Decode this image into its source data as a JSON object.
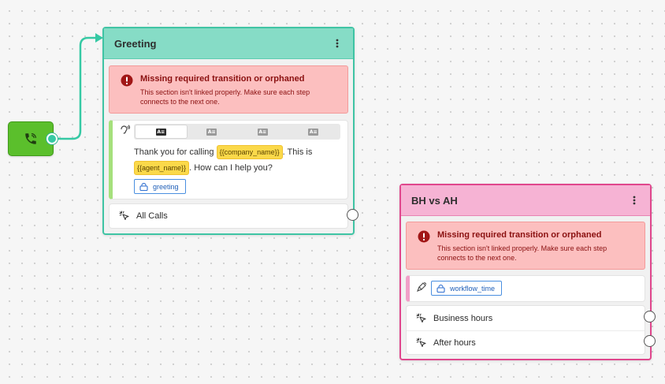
{
  "start_node": {
    "icon": "phone-icon"
  },
  "greeting": {
    "title": "Greeting",
    "menu_icon": "kebab-menu-icon",
    "error": {
      "title": "Missing required transition or orphaned",
      "message": "This section isn't linked properly. Make sure each step connects to the next one."
    },
    "say": {
      "tabs": [
        "A≡",
        "A≡",
        "A≡",
        "A≡"
      ],
      "active_tab": 0,
      "message_before": "Thank you for calling ",
      "var_company": "{{company_name}}",
      "message_mid": ". This is ",
      "var_agent": "{{agent_name}}",
      "message_after": ". How can I help you?",
      "tag": "greeting"
    },
    "transitions": [
      "All Calls"
    ]
  },
  "bh_vs_ah": {
    "title": "BH vs AH",
    "menu_icon": "kebab-menu-icon",
    "error": {
      "title": "Missing required transition or orphaned",
      "message": "This section isn't linked properly. Make sure each step connects to the next one."
    },
    "tag": "workflow_time",
    "transitions": [
      "Business hours",
      "After hours"
    ]
  },
  "colors": {
    "greeting_border": "#3fc4a4",
    "greeting_header": "#86dcc6",
    "bh_border": "#e0478d",
    "bh_header": "#f6b3d4",
    "error_bg": "#fcbfbf",
    "error_text": "#8a1010",
    "start_node": "#5bbf2c",
    "variable_chip": "#fbd94a",
    "tag_border": "#4a8fe0"
  }
}
